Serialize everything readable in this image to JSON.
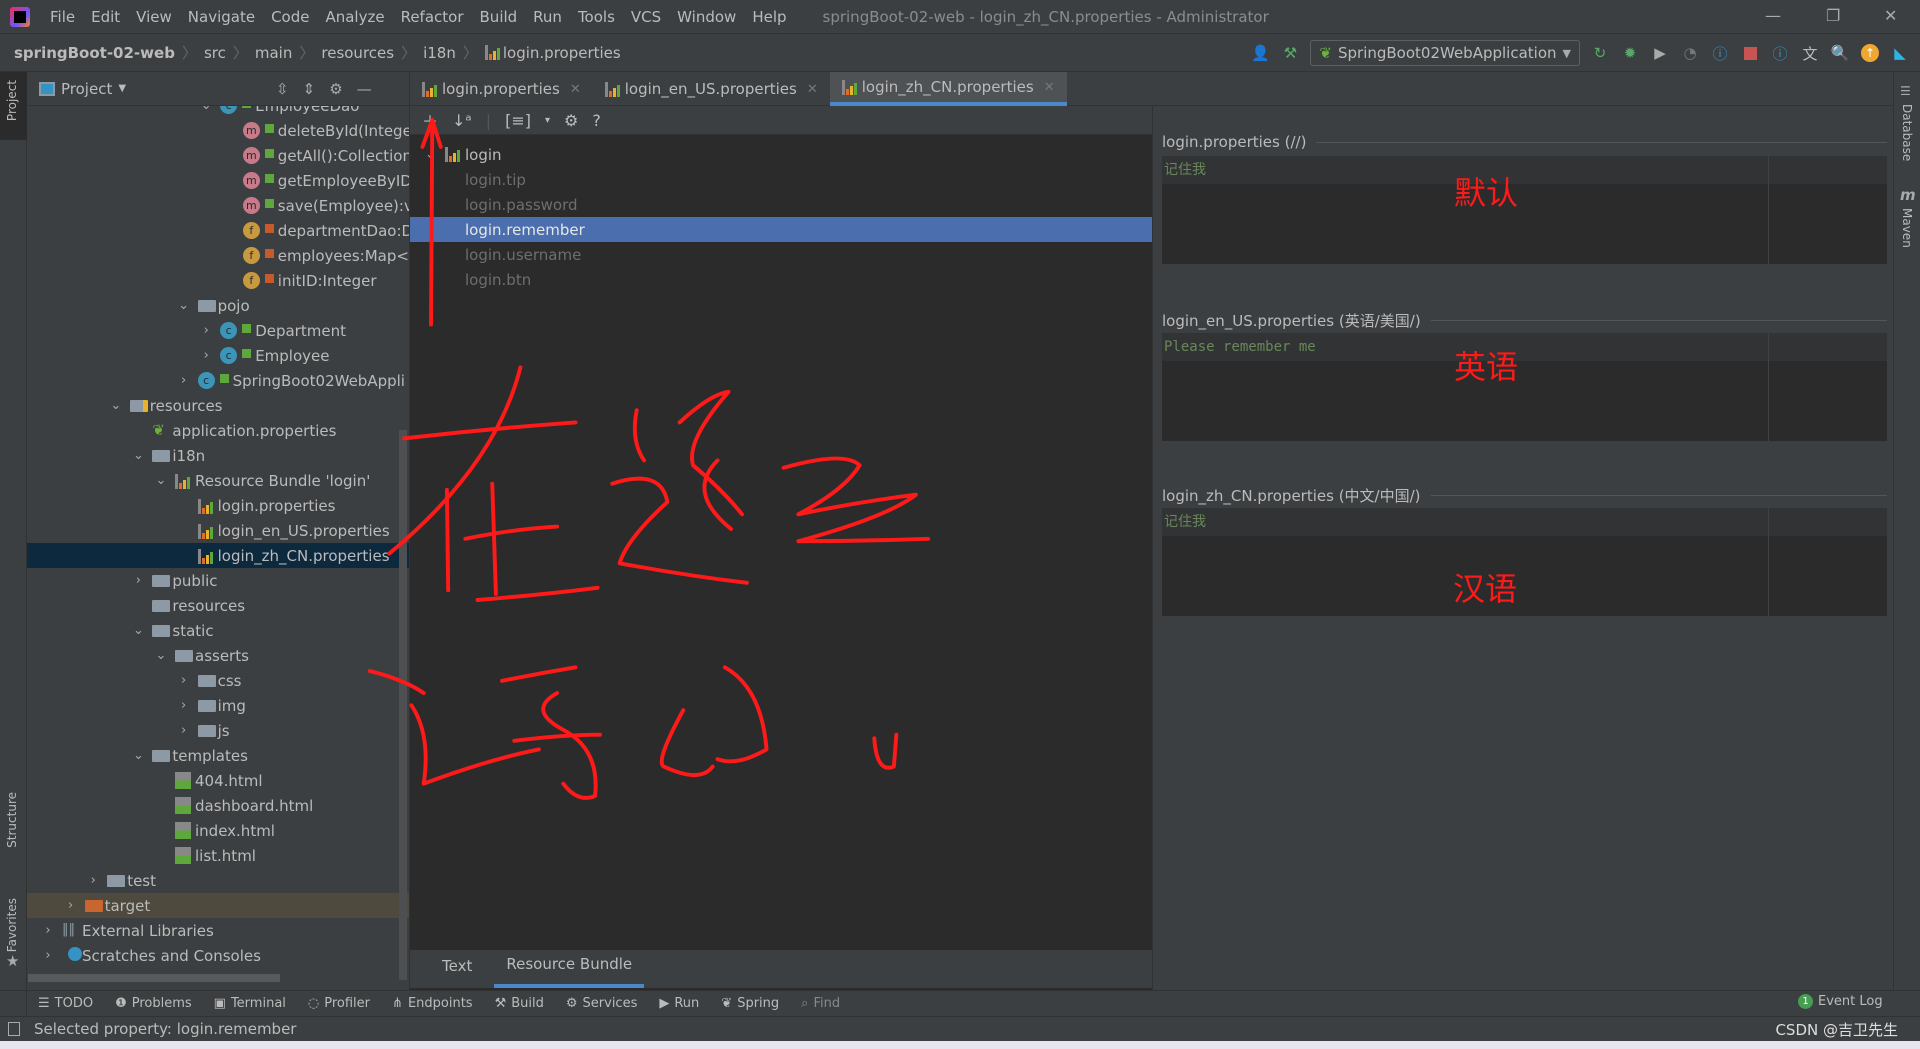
{
  "menu": [
    "File",
    "Edit",
    "View",
    "Navigate",
    "Code",
    "Analyze",
    "Refactor",
    "Build",
    "Run",
    "Tools",
    "VCS",
    "Window",
    "Help"
  ],
  "window_title": "springBoot-02-web - login_zh_CN.properties - Administrator",
  "breadcrumb": [
    "springBoot-02-web",
    "src",
    "main",
    "resources",
    "i18n",
    "login.properties"
  ],
  "run_config": "SpringBoot02WebApplication",
  "project_panel": {
    "title": "Project",
    "tree": [
      {
        "label": "EmployeeDao",
        "level": 7,
        "chev": "open",
        "icon": "class"
      },
      {
        "label": "deleteById(Intege",
        "level": 8,
        "icon": "method"
      },
      {
        "label": "getAll():Collection",
        "level": 8,
        "icon": "method"
      },
      {
        "label": "getEmployeeByID",
        "level": 8,
        "icon": "method"
      },
      {
        "label": "save(Employee):v",
        "level": 8,
        "icon": "method"
      },
      {
        "label": "departmentDao:D",
        "level": 8,
        "icon": "field"
      },
      {
        "label": "employees:Map<",
        "level": 8,
        "icon": "field"
      },
      {
        "label": "initID:Integer",
        "level": 8,
        "icon": "field"
      },
      {
        "label": "pojo",
        "level": 6,
        "chev": "open",
        "icon": "package"
      },
      {
        "label": "Department",
        "level": 7,
        "chev": "closed",
        "icon": "class"
      },
      {
        "label": "Employee",
        "level": 7,
        "chev": "closed",
        "icon": "class"
      },
      {
        "label": "SpringBoot02WebAppli",
        "level": 6,
        "chev": "closed",
        "icon": "springclass"
      },
      {
        "label": "resources",
        "level": 3,
        "chev": "open",
        "icon": "resfolder"
      },
      {
        "label": "application.properties",
        "level": 4,
        "icon": "spring"
      },
      {
        "label": "i18n",
        "level": 4,
        "chev": "open",
        "icon": "folder"
      },
      {
        "label": "Resource Bundle 'login'",
        "level": 5,
        "chev": "open",
        "icon": "bundle"
      },
      {
        "label": "login.properties",
        "level": 6,
        "icon": "prop"
      },
      {
        "label": "login_en_US.properties",
        "level": 6,
        "icon": "prop"
      },
      {
        "label": "login_zh_CN.properties",
        "level": 6,
        "icon": "prop",
        "selected": true
      },
      {
        "label": "public",
        "level": 4,
        "chev": "closed",
        "icon": "folder"
      },
      {
        "label": "resources",
        "level": 4,
        "icon": "folder"
      },
      {
        "label": "static",
        "level": 4,
        "chev": "open",
        "icon": "folder"
      },
      {
        "label": "asserts",
        "level": 5,
        "chev": "open",
        "icon": "folder"
      },
      {
        "label": "css",
        "level": 6,
        "chev": "closed",
        "icon": "folder"
      },
      {
        "label": "img",
        "level": 6,
        "chev": "closed",
        "icon": "folder"
      },
      {
        "label": "js",
        "level": 6,
        "chev": "closed",
        "icon": "folder"
      },
      {
        "label": "templates",
        "level": 4,
        "chev": "open",
        "icon": "folder"
      },
      {
        "label": "404.html",
        "level": 5,
        "icon": "html"
      },
      {
        "label": "dashboard.html",
        "level": 5,
        "icon": "html"
      },
      {
        "label": "index.html",
        "level": 5,
        "icon": "html"
      },
      {
        "label": "list.html",
        "level": 5,
        "icon": "html"
      },
      {
        "label": "test",
        "level": 2,
        "chev": "closed",
        "icon": "folder"
      },
      {
        "label": "target",
        "level": 1,
        "chev": "closed",
        "icon": "excluded",
        "excluded": true
      },
      {
        "label": "External Libraries",
        "level": 0,
        "chev": "closed",
        "icon": "libs"
      },
      {
        "label": "Scratches and Consoles",
        "level": 0,
        "chev": "closed",
        "icon": "scratch"
      }
    ]
  },
  "tabs": [
    {
      "label": "login.properties"
    },
    {
      "label": "login_en_US.properties"
    },
    {
      "label": "login_zh_CN.properties",
      "active": true
    }
  ],
  "bundle": {
    "root": "login",
    "keys": [
      {
        "key": "login.tip"
      },
      {
        "key": "login.password"
      },
      {
        "key": "login.remember",
        "selected": true
      },
      {
        "key": "login.username"
      },
      {
        "key": "login.btn"
      }
    ]
  },
  "editor_bottom_tabs": [
    {
      "label": "Text"
    },
    {
      "label": "Resource Bundle",
      "active": true
    }
  ],
  "values": [
    {
      "file": "login.properties (//)",
      "value": "记住我",
      "annotation": "默认"
    },
    {
      "file": "login_en_US.properties (英语/美国/)",
      "value": "Please remember me",
      "annotation": "英语"
    },
    {
      "file": "login_zh_CN.properties (中文/中国/)",
      "value": "记住我",
      "annotation": "汉语"
    }
  ],
  "side_tabs": {
    "left": [
      "Project",
      "Structure",
      "Favorites"
    ],
    "right": [
      "Database",
      "Maven"
    ]
  },
  "tool_windows": [
    "TODO",
    "Problems",
    "Terminal",
    "Profiler",
    "Endpoints",
    "Build",
    "Services",
    "Run",
    "Spring",
    "Find"
  ],
  "event_log": {
    "label": "Event Log",
    "count": "1"
  },
  "status": "Selected property: login.remember",
  "watermark": "CSDN @吉卫先生",
  "handwriting": "在这里写出",
  "colors": {
    "accent": "#4a88c7",
    "selection": "#4b6eaf",
    "value_green": "#6a8759",
    "annotation_red": "#ff1a1a"
  }
}
